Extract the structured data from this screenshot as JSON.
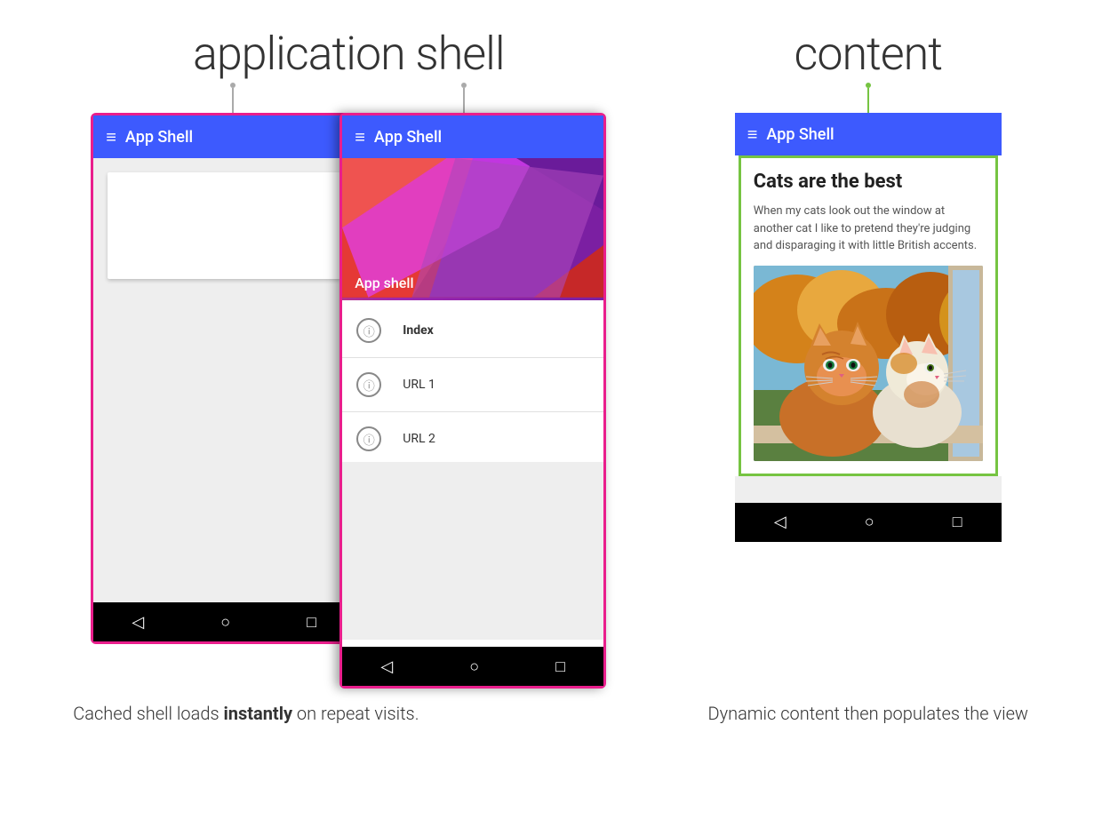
{
  "labels": {
    "application_shell": "application shell",
    "content": "content"
  },
  "phone1": {
    "app_bar_title": "App Shell",
    "hamburger": "≡"
  },
  "phone2": {
    "app_bar_title": "App Shell",
    "hamburger": "≡",
    "drawer_header_title": "App shell",
    "drawer_items": [
      {
        "label": "Index",
        "bold": true
      },
      {
        "label": "URL 1",
        "bold": false
      },
      {
        "label": "URL 2",
        "bold": false
      }
    ]
  },
  "phone3": {
    "app_bar_title": "App Shell",
    "hamburger": "≡",
    "content_title": "Cats are the best",
    "content_text": "When my cats look out the window at another cat I like to pretend they're judging and disparaging it with little British accents."
  },
  "nav_bar": {
    "back": "◁",
    "home": "○",
    "recent": "□"
  },
  "captions": {
    "left": [
      "Cached shell loads ",
      "instantly",
      " on repeat visits."
    ],
    "right": "Dynamic content then populates the view"
  }
}
